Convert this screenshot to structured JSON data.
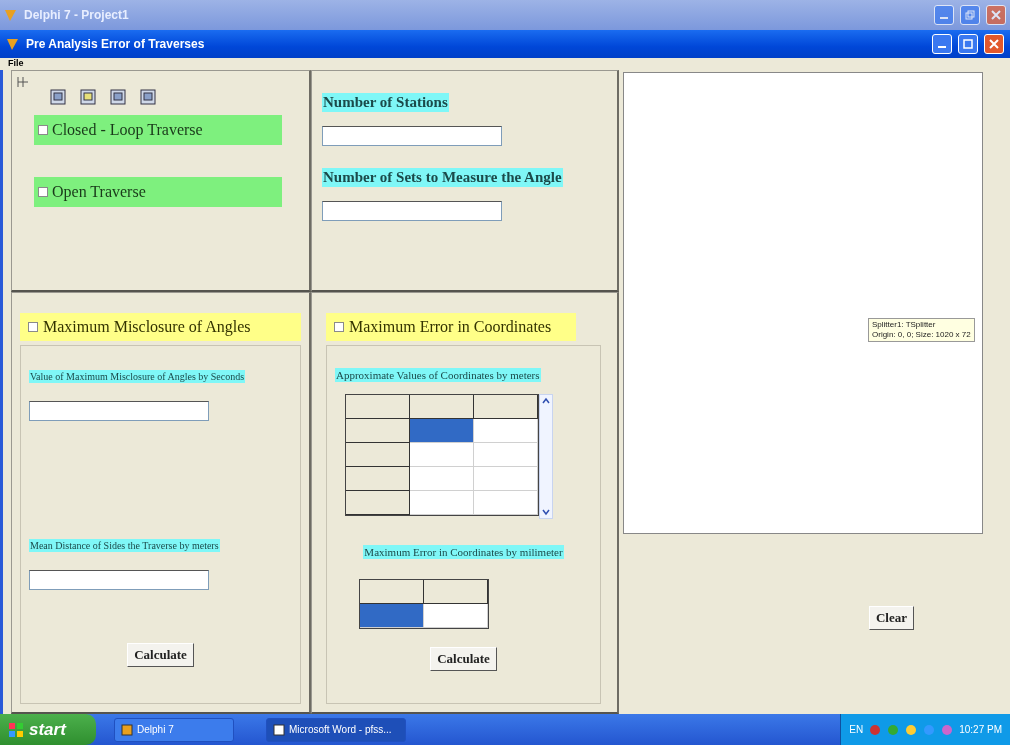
{
  "outer_window": {
    "title": "Delphi 7 - Project1"
  },
  "window": {
    "title": "Pre Analysis Error of Traverses"
  },
  "menu": [
    "File"
  ],
  "traverse_options": [
    {
      "label": "Closed - Loop Traverse",
      "checked": false
    },
    {
      "label": "Open Traverse",
      "checked": false
    }
  ],
  "traverse_fields": [
    {
      "label": "Number of Stations"
    },
    {
      "label": "Number of Sets to Measure the Angle"
    }
  ],
  "misclosure": {
    "label": "Maximum Misclosure of Angles",
    "checked": false,
    "fields": [
      {
        "label": "Value of Maximum Misclosure of Angles by Seconds"
      },
      {
        "label": "Mean Distance of Sides the Traverse by meters"
      }
    ],
    "button": "Calculate"
  },
  "coordinates": {
    "label": "Maximum Error in Coordinates",
    "checked": false,
    "grid_label": "Approximate Values of Coordinates by meters",
    "grid": [
      [
        {
          "kind": "fixed",
          "selected": false
        },
        {
          "kind": "fixed",
          "selected": false
        },
        {
          "kind": "fixed",
          "selected": false
        }
      ],
      [
        {
          "kind": "fixed",
          "selected": false
        },
        {
          "kind": "cell",
          "selected": true
        },
        {
          "kind": "cell",
          "selected": false
        }
      ],
      [
        {
          "kind": "fixed",
          "selected": false
        },
        {
          "kind": "cell",
          "selected": false
        },
        {
          "kind": "cell",
          "selected": false
        }
      ],
      [
        {
          "kind": "fixed",
          "selected": false
        },
        {
          "kind": "cell",
          "selected": false
        },
        {
          "kind": "cell",
          "selected": false
        }
      ],
      [
        {
          "kind": "fixed",
          "selected": false
        },
        {
          "kind": "cell",
          "selected": false
        },
        {
          "kind": "cell",
          "selected": false
        }
      ]
    ],
    "result_label": "Maximum Error in Coordinates by milimeter",
    "result_grid": [
      [
        {
          "kind": "fixed",
          "selected": false
        },
        {
          "kind": "fixed",
          "selected": false
        }
      ],
      [
        {
          "kind": "cell",
          "selected": true
        },
        {
          "kind": "cell",
          "selected": false
        }
      ]
    ],
    "button": "Calculate"
  },
  "clear_button": "Clear",
  "tooltip": [
    "Splitter1: TSplitter",
    "Origin: 0, 0; Size: 1020 x 72"
  ],
  "taskbar": {
    "start": "start",
    "tasks": [
      {
        "label": "Delphi 7",
        "selected": false
      },
      {
        "label": "Microsoft Word - pfss...",
        "selected": true
      }
    ],
    "language": "EN",
    "clock": "10:27 PM"
  }
}
